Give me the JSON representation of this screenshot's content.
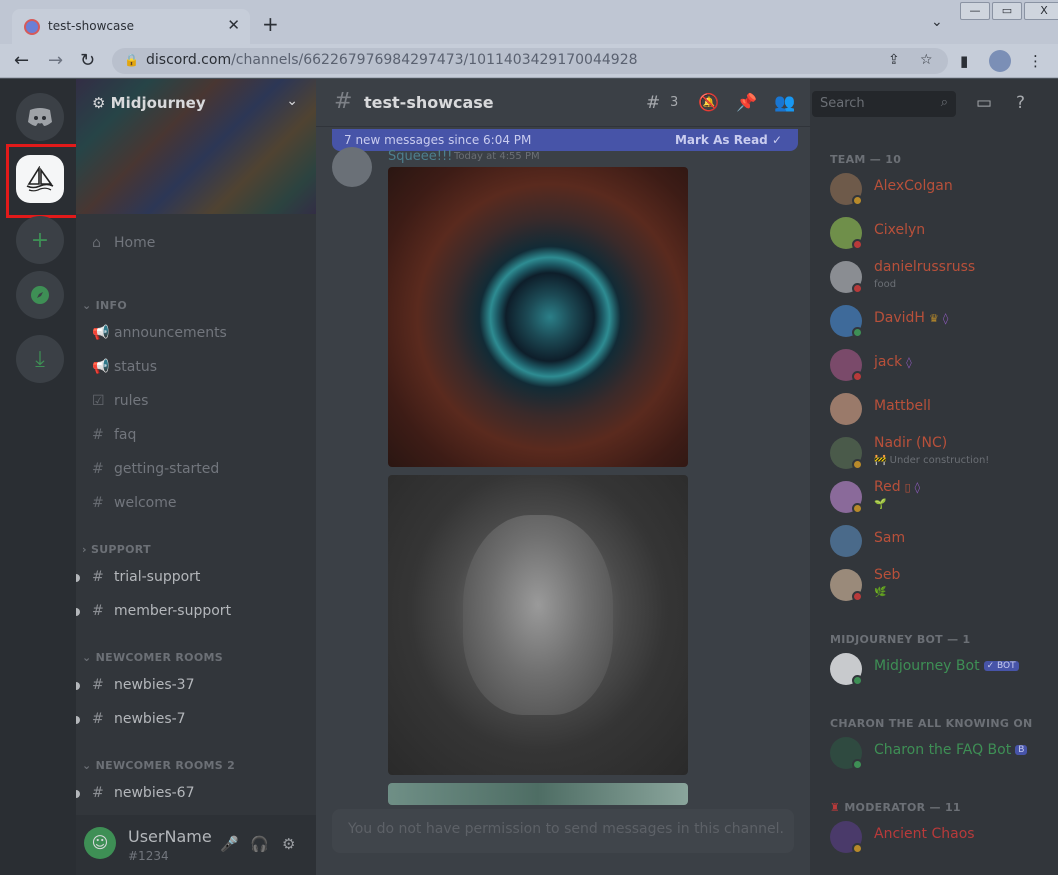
{
  "browser": {
    "tab_title": "test-showcase",
    "url_host": "discord.com",
    "url_path": "/channels/662267976984297473/1011403429170044928",
    "win_min": "—",
    "win_max": "▭",
    "win_close": "X"
  },
  "server": {
    "name": "Midjourney"
  },
  "sidebar": {
    "home": "Home",
    "categories": {
      "info": "INFO",
      "support": "SUPPORT",
      "newcomer": "NEWCOMER ROOMS",
      "newcomer2": "NEWCOMER ROOMS 2"
    },
    "channels": {
      "announcements": "announcements",
      "status": "status",
      "rules": "rules",
      "faq": "faq",
      "getting_started": "getting-started",
      "welcome": "welcome",
      "trial_support": "trial-support",
      "member_support": "member-support",
      "newbies_37": "newbies-37",
      "newbies_7": "newbies-7",
      "newbies_67": "newbies-67"
    }
  },
  "user": {
    "name": "UserName",
    "tag": "#1234"
  },
  "channel": {
    "name": "test-showcase",
    "thread_count": "3",
    "new_messages": "7 new messages since 6:04 PM",
    "mark_as_read": "Mark As Read",
    "author": "Squeee!!!",
    "timestamp": "Today at 4:55 PM",
    "composer_placeholder": "You do not have permission to send messages in this channel."
  },
  "members_panel": {
    "search_placeholder": "Search",
    "groups": {
      "team": "TEAM — 10",
      "bot": "MIDJOURNEY BOT — 1",
      "charon": "CHARON THE ALL KNOWING ON",
      "moderator": "MODERATOR — 11"
    },
    "team": [
      {
        "name": "AlexColgan",
        "sub": ""
      },
      {
        "name": "Cixelyn",
        "sub": ""
      },
      {
        "name": "danielrussruss",
        "sub": "food"
      },
      {
        "name": "DavidH",
        "sub": ""
      },
      {
        "name": "jack",
        "sub": ""
      },
      {
        "name": "Mattbell",
        "sub": ""
      },
      {
        "name": "Nadir (NC)",
        "sub": "Under construction!"
      },
      {
        "name": "Red",
        "sub": ""
      },
      {
        "name": "Sam",
        "sub": ""
      },
      {
        "name": "Seb",
        "sub": ""
      }
    ],
    "bot_name": "Midjourney Bot",
    "bot_tag": "✓ BOT",
    "charon_name": "Charon the FAQ Bot",
    "charon_tag": "B",
    "moderator_first": "Ancient Chaos"
  },
  "colors": {
    "highlight": "#e21a1a",
    "accent": "#4754a8",
    "online": "#3e8f55",
    "dnd": "#b83a3a",
    "idle": "#b88a2a"
  }
}
